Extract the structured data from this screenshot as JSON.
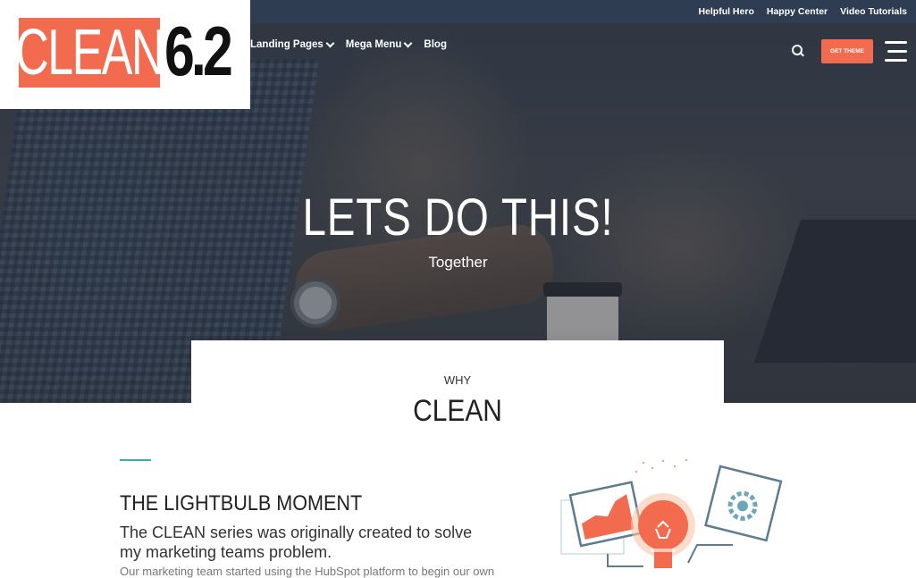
{
  "topbar": {
    "links": [
      "Helpful Hero",
      "Happy Center",
      "Video Tutorials"
    ]
  },
  "logo": {
    "word": "CLEAN",
    "version": "6.2"
  },
  "nav": {
    "items": [
      "Landing Pages",
      "Mega Menu",
      "Blog"
    ]
  },
  "header": {
    "cta_label": "GET THEME"
  },
  "hero": {
    "title": "LETS DO THIS!",
    "subtitle": "Together"
  },
  "why": {
    "kicker": "WHY",
    "title": "CLEAN"
  },
  "feature": {
    "title": "THE LIGHTBULB MOMENT",
    "text": "The CLEAN series was originally created to solve my marketing teams problem.",
    "cut_text": "Our marketing team started using the HubSpot platform to begin our own"
  },
  "colors": {
    "accent": "#f26b4f",
    "nav_bar": "#2e3d52",
    "teal": "#36b1b1"
  }
}
